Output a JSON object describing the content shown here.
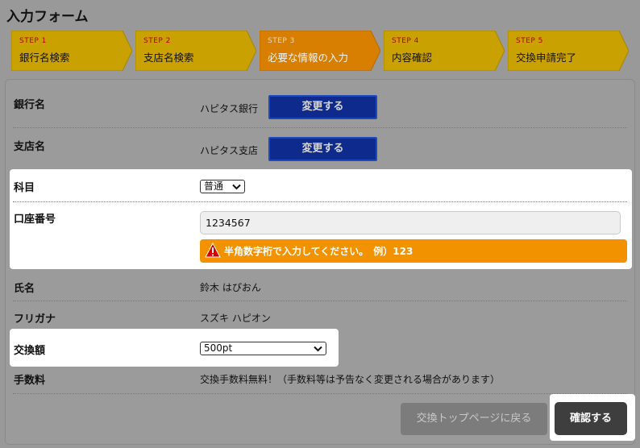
{
  "page": {
    "title": "入力フォーム"
  },
  "steps": [
    {
      "num": "STEP 1",
      "label": "銀行名検索",
      "active": false
    },
    {
      "num": "STEP 2",
      "label": "支店名検索",
      "active": false
    },
    {
      "num": "STEP 3",
      "label": "必要な情報の入力",
      "active": true
    },
    {
      "num": "STEP 4",
      "label": "内容確認",
      "active": false
    },
    {
      "num": "STEP 5",
      "label": "交換申請完了",
      "active": false
    }
  ],
  "form": {
    "bank": {
      "label": "銀行名",
      "value": "ハピタス銀行",
      "button": "変更する"
    },
    "branch": {
      "label": "支店名",
      "value": "ハピタス支店",
      "button": "変更する"
    },
    "account_type": {
      "label": "科目",
      "selected": "普通"
    },
    "account_number": {
      "label": "口座番号",
      "value": "1234567",
      "warning": "半角数字桁で入力してください。　例）123"
    },
    "name": {
      "label": "氏名",
      "value": "鈴木 はぴおん"
    },
    "kana": {
      "label": "フリガナ",
      "value": "スズキ ハピオン"
    },
    "amount": {
      "label": "交換額",
      "selected": "500pt"
    },
    "fee": {
      "label": "手数料",
      "value": "交換手数料無料！（手数料等は予告なく変更される場合があります）"
    }
  },
  "actions": {
    "back": "交換トップページに戻る",
    "confirm": "確認する"
  },
  "colors": {
    "background": "#999999",
    "step_inactive": "#c9a100",
    "step_active": "#d87e00",
    "change_button": "#0d2a8c",
    "warning": "#f39200",
    "confirm_button": "#3e3e3e"
  },
  "icons": {
    "warning": "warning-triangle-icon",
    "select": "chevron-down-icon"
  }
}
